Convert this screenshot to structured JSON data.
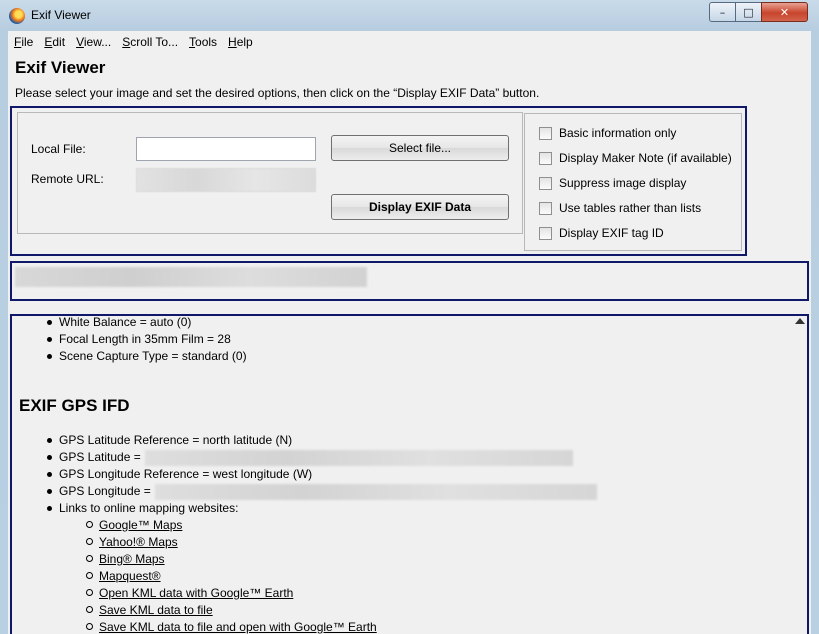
{
  "window": {
    "title": "Exif Viewer",
    "controls": {
      "minimize": "–",
      "maximize": "□",
      "close": "✕"
    }
  },
  "menu": [
    {
      "label_u": "F",
      "label_rest": "ile"
    },
    {
      "label_u": "E",
      "label_rest": "dit"
    },
    {
      "label_u": "V",
      "label_rest": "iew..."
    },
    {
      "label_u": "S",
      "label_rest": "croll To..."
    },
    {
      "label_u": "T",
      "label_rest": "ools"
    },
    {
      "label_u": "H",
      "label_rest": "elp"
    }
  ],
  "header": {
    "title": "Exif Viewer",
    "instructions": "Please select your image and set the desired options, then click on the “Display EXIF Data” button."
  },
  "form": {
    "local_file_label": "Local File:",
    "local_file_value": "",
    "remote_url_label": "Remote URL:",
    "select_file_button": "Select file...",
    "display_button": "Display EXIF Data"
  },
  "options": [
    {
      "label": "Basic information only",
      "checked": false
    },
    {
      "label": "Display Maker Note (if available)",
      "checked": false
    },
    {
      "label": "Suppress image display",
      "checked": false
    },
    {
      "label": "Use tables rather than lists",
      "checked": false
    },
    {
      "label": "Display EXIF tag ID",
      "checked": false
    }
  ],
  "output": {
    "items_top": [
      "White Balance = auto (0)",
      "Focal Length in 35mm Film = 28",
      "Scene Capture Type = standard (0)"
    ],
    "gps_heading": "EXIF GPS IFD",
    "gps_items": [
      "GPS Latitude Reference = north latitude (N)",
      "GPS Latitude =",
      "GPS Longitude Reference = west longitude (W)",
      "GPS Longitude =",
      "Links to online mapping websites:"
    ],
    "map_links": [
      "Google™ Maps",
      "Yahoo!® Maps",
      "Bing® Maps",
      "Mapquest®",
      "Open KML data with Google™ Earth",
      "Save KML data to file",
      "Save KML data to file and open with Google™ Earth"
    ]
  },
  "icons": {
    "app": "firefox-icon",
    "checkbox": "checkbox-unchecked-icon",
    "bullet": "bullet-icon",
    "scroll_up": "scroll-up-arrow-icon"
  }
}
